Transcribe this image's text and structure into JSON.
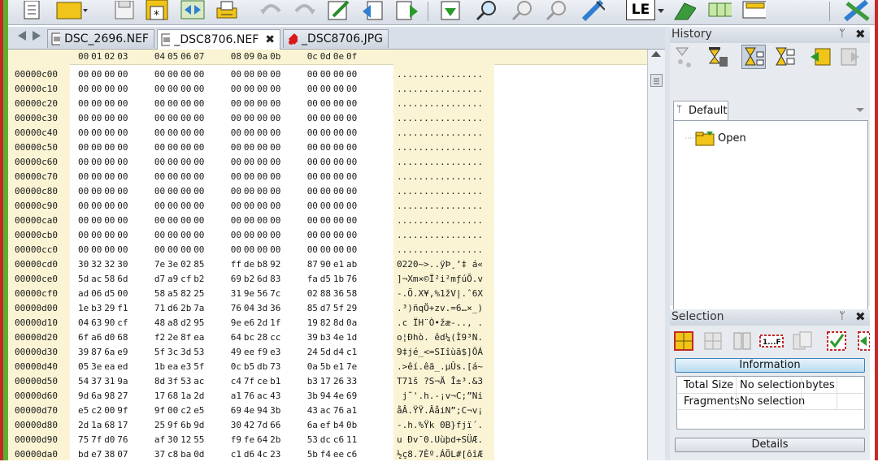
{
  "toolbar": {
    "buttons": [
      "new-file",
      "open-file",
      "save",
      "save-as",
      "compare",
      "print",
      "undo",
      "redo",
      "edit",
      "import",
      "export",
      "download",
      "find",
      "find-previous",
      "find-next",
      "write",
      "endian-mode",
      "highlight",
      "columns",
      "tables",
      "tools"
    ],
    "endian_label": "LE"
  },
  "tabs": [
    {
      "label": "DSC_2696.NEF",
      "icon": "nef-file-icon",
      "active": false
    },
    {
      "label": "_DSC8706.NEF",
      "icon": "nef-file-icon",
      "active": true,
      "close": "✖"
    },
    {
      "label": "_DSC8706.JPG",
      "icon": "jpg-file-icon",
      "active": false
    }
  ],
  "hex": {
    "column_headers": [
      "00",
      "01",
      "02",
      "03",
      "04",
      "05",
      "06",
      "07",
      "08",
      "09",
      "0a",
      "0b",
      "0c",
      "0d",
      "0e",
      "0f"
    ],
    "rows": [
      {
        "addr": "00000c00",
        "bytes": [
          "00",
          "00",
          "00",
          "00",
          "00",
          "00",
          "00",
          "00",
          "00",
          "00",
          "00",
          "00",
          "00",
          "00",
          "00",
          "00"
        ],
        "ascii": "................"
      },
      {
        "addr": "00000c10",
        "bytes": [
          "00",
          "00",
          "00",
          "00",
          "00",
          "00",
          "00",
          "00",
          "00",
          "00",
          "00",
          "00",
          "00",
          "00",
          "00",
          "00"
        ],
        "ascii": "................"
      },
      {
        "addr": "00000c20",
        "bytes": [
          "00",
          "00",
          "00",
          "00",
          "00",
          "00",
          "00",
          "00",
          "00",
          "00",
          "00",
          "00",
          "00",
          "00",
          "00",
          "00"
        ],
        "ascii": "................"
      },
      {
        "addr": "00000c30",
        "bytes": [
          "00",
          "00",
          "00",
          "00",
          "00",
          "00",
          "00",
          "00",
          "00",
          "00",
          "00",
          "00",
          "00",
          "00",
          "00",
          "00"
        ],
        "ascii": "................"
      },
      {
        "addr": "00000c40",
        "bytes": [
          "00",
          "00",
          "00",
          "00",
          "00",
          "00",
          "00",
          "00",
          "00",
          "00",
          "00",
          "00",
          "00",
          "00",
          "00",
          "00"
        ],
        "ascii": "................"
      },
      {
        "addr": "00000c50",
        "bytes": [
          "00",
          "00",
          "00",
          "00",
          "00",
          "00",
          "00",
          "00",
          "00",
          "00",
          "00",
          "00",
          "00",
          "00",
          "00",
          "00"
        ],
        "ascii": "................"
      },
      {
        "addr": "00000c60",
        "bytes": [
          "00",
          "00",
          "00",
          "00",
          "00",
          "00",
          "00",
          "00",
          "00",
          "00",
          "00",
          "00",
          "00",
          "00",
          "00",
          "00"
        ],
        "ascii": "................"
      },
      {
        "addr": "00000c70",
        "bytes": [
          "00",
          "00",
          "00",
          "00",
          "00",
          "00",
          "00",
          "00",
          "00",
          "00",
          "00",
          "00",
          "00",
          "00",
          "00",
          "00"
        ],
        "ascii": "................"
      },
      {
        "addr": "00000c80",
        "bytes": [
          "00",
          "00",
          "00",
          "00",
          "00",
          "00",
          "00",
          "00",
          "00",
          "00",
          "00",
          "00",
          "00",
          "00",
          "00",
          "00"
        ],
        "ascii": "................"
      },
      {
        "addr": "00000c90",
        "bytes": [
          "00",
          "00",
          "00",
          "00",
          "00",
          "00",
          "00",
          "00",
          "00",
          "00",
          "00",
          "00",
          "00",
          "00",
          "00",
          "00"
        ],
        "ascii": "................"
      },
      {
        "addr": "00000ca0",
        "bytes": [
          "00",
          "00",
          "00",
          "00",
          "00",
          "00",
          "00",
          "00",
          "00",
          "00",
          "00",
          "00",
          "00",
          "00",
          "00",
          "00"
        ],
        "ascii": "................"
      },
      {
        "addr": "00000cb0",
        "bytes": [
          "00",
          "00",
          "00",
          "00",
          "00",
          "00",
          "00",
          "00",
          "00",
          "00",
          "00",
          "00",
          "00",
          "00",
          "00",
          "00"
        ],
        "ascii": "................"
      },
      {
        "addr": "00000cc0",
        "bytes": [
          "00",
          "00",
          "00",
          "00",
          "00",
          "00",
          "00",
          "00",
          "00",
          "00",
          "00",
          "00",
          "00",
          "00",
          "00",
          "00"
        ],
        "ascii": "................"
      },
      {
        "addr": "00000cd0",
        "bytes": [
          "30",
          "32",
          "32",
          "30",
          "7e",
          "3e",
          "02",
          "85",
          "ff",
          "de",
          "b8",
          "92",
          "87",
          "90",
          "e1",
          "ab"
        ],
        "ascii": "0220~>..ÿÞ¸’‡ á«"
      },
      {
        "addr": "00000ce0",
        "bytes": [
          "5d",
          "ac",
          "58",
          "6d",
          "d7",
          "a9",
          "cf",
          "b2",
          "69",
          "b2",
          "6d",
          "83",
          "fa",
          "d5",
          "1b",
          "76"
        ],
        "ascii": "]¬Xm×©Ï²i²mƒúÕ.v"
      },
      {
        "addr": "00000cf0",
        "bytes": [
          "ad",
          "06",
          "d5",
          "00",
          "58",
          "a5",
          "82",
          "25",
          "31",
          "9e",
          "56",
          "7c",
          "02",
          "88",
          "36",
          "58"
        ],
        "ascii": "-.Õ.X¥,%1žV|.ˆ6X"
      },
      {
        "addr": "00000d00",
        "bytes": [
          "1e",
          "b3",
          "29",
          "f1",
          "71",
          "d6",
          "2b",
          "7a",
          "76",
          "04",
          "3d",
          "36",
          "85",
          "d7",
          "5f",
          "29"
        ],
        "ascii": ".³)ñqÖ+zv.=6…×_)"
      },
      {
        "addr": "00000d10",
        "bytes": [
          "04",
          "63",
          "90",
          "cf",
          "48",
          "a8",
          "d2",
          "95",
          "9e",
          "e6",
          "2d",
          "1f",
          "19",
          "82",
          "8d",
          "0a"
        ],
        "ascii": ".c ÏH¨Ò•žæ-.., ."
      },
      {
        "addr": "00000d20",
        "bytes": [
          "6f",
          "a6",
          "d0",
          "68",
          "f2",
          "2e",
          "8f",
          "ea",
          "64",
          "bc",
          "28",
          "cc",
          "39",
          "b3",
          "4e",
          "1d"
        ],
        "ascii": "o¦Ðhò. êd¼(Ì9³N."
      },
      {
        "addr": "00000d30",
        "bytes": [
          "39",
          "87",
          "6a",
          "e9",
          "5f",
          "3c",
          "3d",
          "53",
          "49",
          "ee",
          "f9",
          "e3",
          "24",
          "5d",
          "d4",
          "c1"
        ],
        "ascii": "9‡jé_<=SIîùã$]ÔÁ"
      },
      {
        "addr": "00000d40",
        "bytes": [
          "05",
          "3e",
          "ea",
          "ed",
          "1b",
          "ea",
          "e3",
          "5f",
          "0c",
          "b5",
          "db",
          "73",
          "0a",
          "5b",
          "e1",
          "7e"
        ],
        "ascii": ".>êí.êã_.µÛs.[á~"
      },
      {
        "addr": "00000d50",
        "bytes": [
          "54",
          "37",
          "31",
          "9a",
          "8d",
          "3f",
          "53",
          "ac",
          "c4",
          "7f",
          "ce",
          "b1",
          "b3",
          "17",
          "26",
          "33"
        ],
        "ascii": "T71š ?S¬Ä Î±³.&3"
      },
      {
        "addr": "00000d60",
        "bytes": [
          "9d",
          "6a",
          "98",
          "27",
          "17",
          "68",
          "1a",
          "2d",
          "a1",
          "76",
          "ac",
          "43",
          "3b",
          "94",
          "4e",
          "69"
        ],
        "ascii": " j˜'.h.-¡v¬C;”Ni"
      },
      {
        "addr": "00000d70",
        "bytes": [
          "e5",
          "c2",
          "00",
          "9f",
          "9f",
          "00",
          "c2",
          "e5",
          "69",
          "4e",
          "94",
          "3b",
          "43",
          "ac",
          "76",
          "a1"
        ],
        "ascii": "åÂ.ŸŸ.ÂåiN”;C¬v¡"
      },
      {
        "addr": "00000d80",
        "bytes": [
          "2d",
          "1a",
          "68",
          "17",
          "25",
          "9f",
          "6b",
          "9d",
          "30",
          "42",
          "7d",
          "66",
          "6a",
          "ef",
          "b4",
          "0b"
        ],
        "ascii": "-.h.%Ÿk 0B}fjï´."
      },
      {
        "addr": "00000d90",
        "bytes": [
          "75",
          "7f",
          "d0",
          "76",
          "af",
          "30",
          "12",
          "55",
          "f9",
          "fe",
          "64",
          "2b",
          "53",
          "dc",
          "c6",
          "11"
        ],
        "ascii": "u Ðv¯0.Uùþd+SÜÆ."
      },
      {
        "addr": "00000da0",
        "bytes": [
          "bd",
          "e7",
          "38",
          "07",
          "37",
          "c8",
          "ba",
          "0d",
          "c1",
          "d6",
          "4c",
          "23",
          "5b",
          "f4",
          "ee",
          "c6"
        ],
        "ascii": "½ç8.7Èº.ÁÖL#[ôîÆ"
      }
    ]
  },
  "history": {
    "title": "History",
    "pin": "ᛘ",
    "close": "✖",
    "tab_label": "Default",
    "items": [
      {
        "label": "Open",
        "icon": "open-folder-icon"
      }
    ]
  },
  "selection": {
    "title": "Selection",
    "pin": "ᛘ",
    "close": "✖",
    "tool_label": "1...F",
    "information_label": "Information",
    "rows": [
      {
        "label": "Total Size",
        "value": "No selection",
        "unit": "bytes"
      },
      {
        "label": "Fragments",
        "value": "No selection",
        "unit": ""
      }
    ],
    "details_label": "Details"
  }
}
